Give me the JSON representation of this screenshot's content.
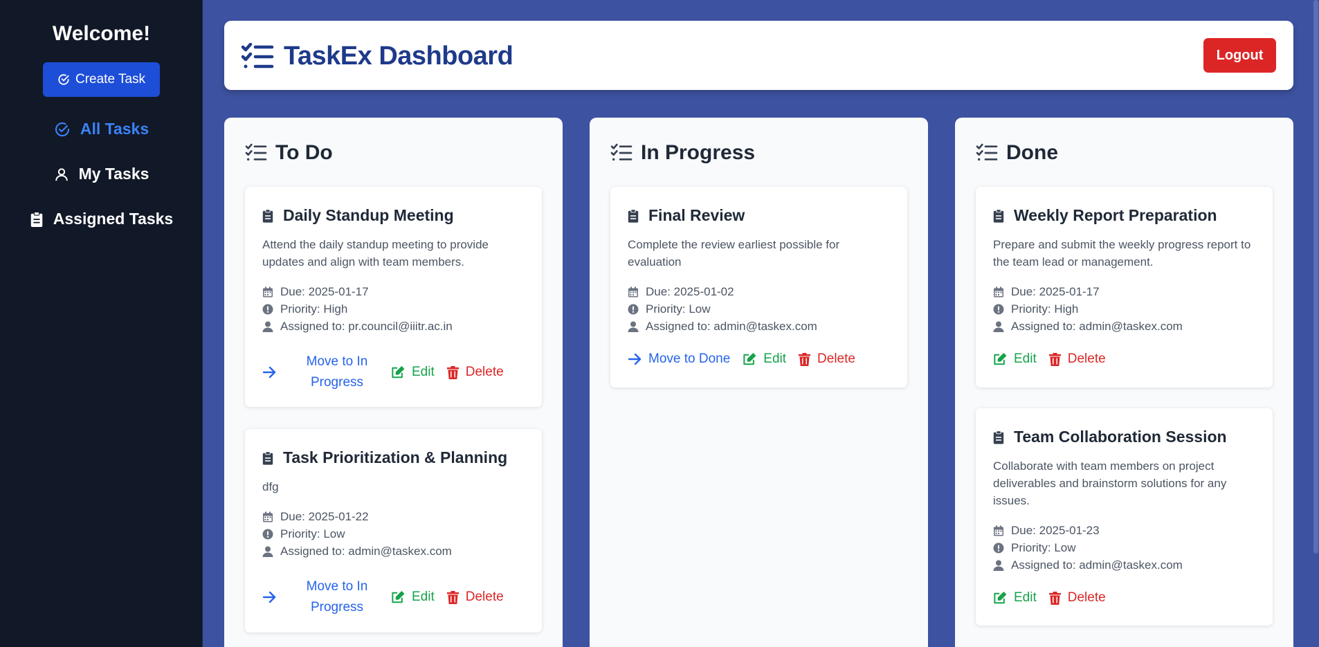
{
  "sidebar": {
    "welcome": "Welcome!",
    "create_label": "Create Task",
    "nav": [
      {
        "label": "All Tasks",
        "icon": "check-circle-icon",
        "active": true
      },
      {
        "label": "My Tasks",
        "icon": "user-icon",
        "active": false
      },
      {
        "label": "Assigned Tasks",
        "icon": "clipboard-icon",
        "active": false
      }
    ]
  },
  "header": {
    "title": "TaskEx Dashboard",
    "logout_label": "Logout"
  },
  "colors": {
    "background": "#3d52a0",
    "sidebar": "#111827",
    "primary": "#1d4ed8",
    "brand": "#1e3a8a",
    "danger": "#dc2626",
    "success": "#16a34a",
    "link": "#2563eb"
  },
  "columns": [
    {
      "title": "To Do",
      "cards": [
        {
          "title": "Daily Standup Meeting",
          "description": "Attend the daily standup meeting to provide updates and align with team members.",
          "due": "Due: 2025-01-17",
          "priority": "Priority: High",
          "assigned": "Assigned to: pr.council@iiitr.ac.in",
          "move_label": "Move to In Progress",
          "edit_label": "Edit",
          "delete_label": "Delete"
        },
        {
          "title": "Task Prioritization & Planning",
          "description": "dfg",
          "due": "Due: 2025-01-22",
          "priority": "Priority: Low",
          "assigned": "Assigned to: admin@taskex.com",
          "move_label": "Move to In Progress",
          "edit_label": "Edit",
          "delete_label": "Delete"
        }
      ]
    },
    {
      "title": "In Progress",
      "cards": [
        {
          "title": "Final Review",
          "description": "Complete the review earliest possible for evaluation",
          "due": "Due: 2025-01-02",
          "priority": "Priority: Low",
          "assigned": "Assigned to: admin@taskex.com",
          "move_label": "Move to Done",
          "edit_label": "Edit",
          "delete_label": "Delete"
        }
      ]
    },
    {
      "title": "Done",
      "cards": [
        {
          "title": "Weekly Report Preparation",
          "description": "Prepare and submit the weekly progress report to the team lead or management.",
          "due": "Due: 2025-01-17",
          "priority": "Priority: High",
          "assigned": "Assigned to: admin@taskex.com",
          "edit_label": "Edit",
          "delete_label": "Delete"
        },
        {
          "title": "Team Collaboration Session",
          "description": "Collaborate with team members on project deliverables and brainstorm solutions for any issues.",
          "due": "Due: 2025-01-23",
          "priority": "Priority: Low",
          "assigned": "Assigned to: admin@taskex.com",
          "edit_label": "Edit",
          "delete_label": "Delete"
        }
      ]
    }
  ]
}
